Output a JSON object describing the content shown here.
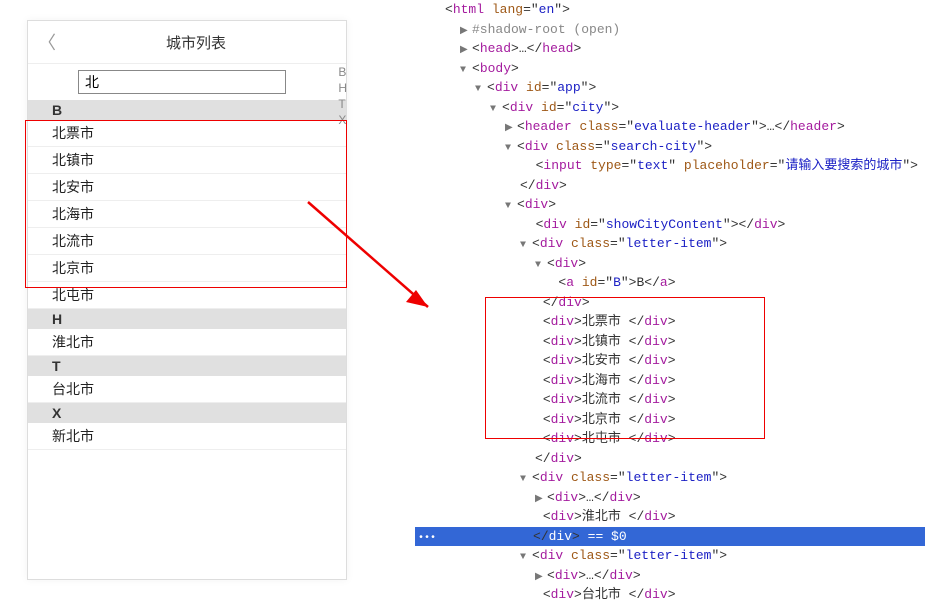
{
  "header": {
    "title": "城市列表"
  },
  "search": {
    "value": "北",
    "placeholder": "请输入要搜索的城市"
  },
  "index_bar": [
    "B",
    "H",
    "T",
    "X"
  ],
  "sections": [
    {
      "letter": "B",
      "cities": [
        "北票市",
        "北镇市",
        "北安市",
        "北海市",
        "北流市",
        "北京市",
        "北屯市"
      ]
    },
    {
      "letter": "H",
      "cities": [
        "淮北市"
      ]
    },
    {
      "letter": "T",
      "cities": [
        "台北市"
      ]
    },
    {
      "letter": "X",
      "cities": [
        "新北市"
      ]
    }
  ],
  "dom": {
    "html_open": "html",
    "lang": "en",
    "shadow": "#shadow-root (open)",
    "head": "head",
    "body": "body",
    "app_id": "app",
    "city_id": "city",
    "header_el": "header",
    "header_class": "evaluate-header",
    "search_class": "search-city",
    "input_el": "input",
    "input_type": "text",
    "showcity_id": "showCityContent",
    "letter_item": "letter-item",
    "anchor_b": "B",
    "highlighted": "</div>",
    "eq0": " == $0"
  }
}
